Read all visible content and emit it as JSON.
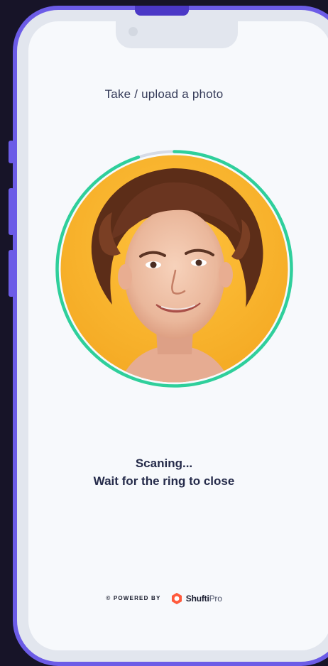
{
  "screen": {
    "title": "Take / upload a photo",
    "status_line1": "Scaning...",
    "status_line2": "Wait for the ring to close"
  },
  "footer": {
    "powered_by": "© POWERED BY",
    "brand_name": "Shufti",
    "brand_suffix": "Pro"
  },
  "scan": {
    "progress": 0.95
  },
  "colors": {
    "phone_frame": "#6c5ce7",
    "ring_progress": "#2fcf9b",
    "ring_track": "#d6dbe6",
    "photo_bg": "#f7b52c",
    "brand_logo": "#ff5a3c"
  },
  "icons": {
    "brand_logo": "shufti-logo-icon",
    "camera": "front-camera-icon"
  }
}
